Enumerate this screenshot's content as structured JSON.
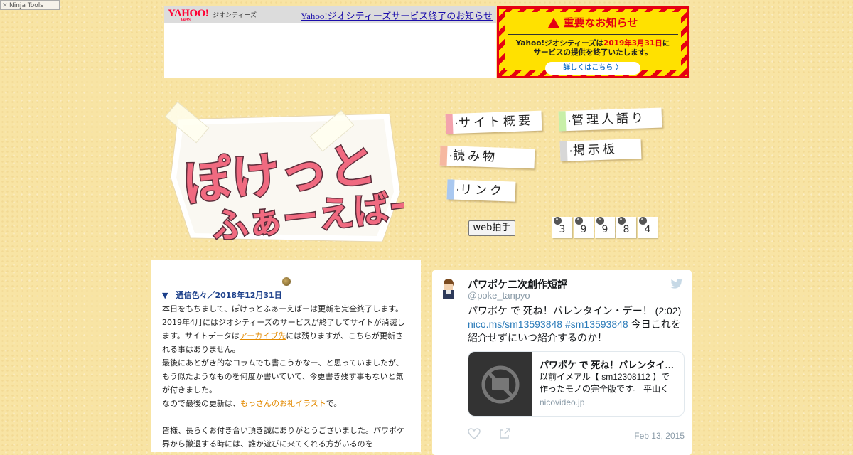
{
  "ninja": {
    "label": "Ninja Tools"
  },
  "yahoo": {
    "logo": "YAHOO!",
    "logo_sub": "JAPAN",
    "service": "ジオシティーズ",
    "link": "Yahoo!ジオシティーズサービス終了のお知らせ"
  },
  "notice": {
    "title": "重要なお知らせ",
    "text_a": "Yahoo!ジオシティーズは",
    "date": "2019年3月31日",
    "text_b": "に",
    "text_c": "サービスの提供を終了いたします。",
    "button": "詳しくはこちら 〉"
  },
  "site": {
    "logo_line1": "ぽけっと",
    "logo_line2": "ふぁーえばー"
  },
  "nav": [
    {
      "label": "サイト概要",
      "color": "#f3a3ad"
    },
    {
      "label": "管理人語り",
      "color": "#c8efa8"
    },
    {
      "label": "読み物",
      "color": "#f6b8a0"
    },
    {
      "label": "掲示板",
      "color": "#d7d7d7"
    },
    {
      "label": "リンク",
      "color": "#a9c8f0"
    }
  ],
  "clap": {
    "label": "web拍手"
  },
  "counter": [
    "3",
    "9",
    "9",
    "8",
    "4"
  ],
  "article": {
    "heading": "▼　通信色々／2018年12月31日",
    "p1_a": "本日をもちまして、ぽけっとふぁーえばーは更新を完全終了します。2019年4月にはジオシティーズのサービスが終了してサイトが消滅します。サイトデータは",
    "p1_link": "アーカイブ先",
    "p1_b": "には残りますが、こちらが更新される事はありません。",
    "p2": "最後にあとがき的なコラムでも書こうかなー、と思っていましたが、もう似たようなものを何度か書いていて、今更書き残す事もないと気が付きました。",
    "p3_a": "なので最後の更新は、",
    "p3_link": "もっさんのお礼イラスト",
    "p3_b": "で。",
    "p4": "皆様、長らくお付き合い頂き誠にありがとうございました。パワポケ界から撤退する時には、誰か遊びに来てくれる方がいるのを"
  },
  "tweet": {
    "name": "パワポケ二次創作短評",
    "handle": "@poke_tanpyo",
    "text_a": "パワポケ で 死ね！バレンタイン・デー！ (2:02)",
    "link1": "nico.ms/sm13593848",
    "link2": "#sm13593848",
    "text_b": " 今日これを紹介せずにいつ紹介するのか！",
    "card_title": "パワポケ で 死ね！バレンタイン・デー！",
    "card_desc": "以前イメアル【 sm12308112 】で作ったモノの完全版です。 平山く",
    "card_url": "nicovideo.jp",
    "date": "Feb 13, 2015",
    "accent": "#2b7bb9"
  }
}
